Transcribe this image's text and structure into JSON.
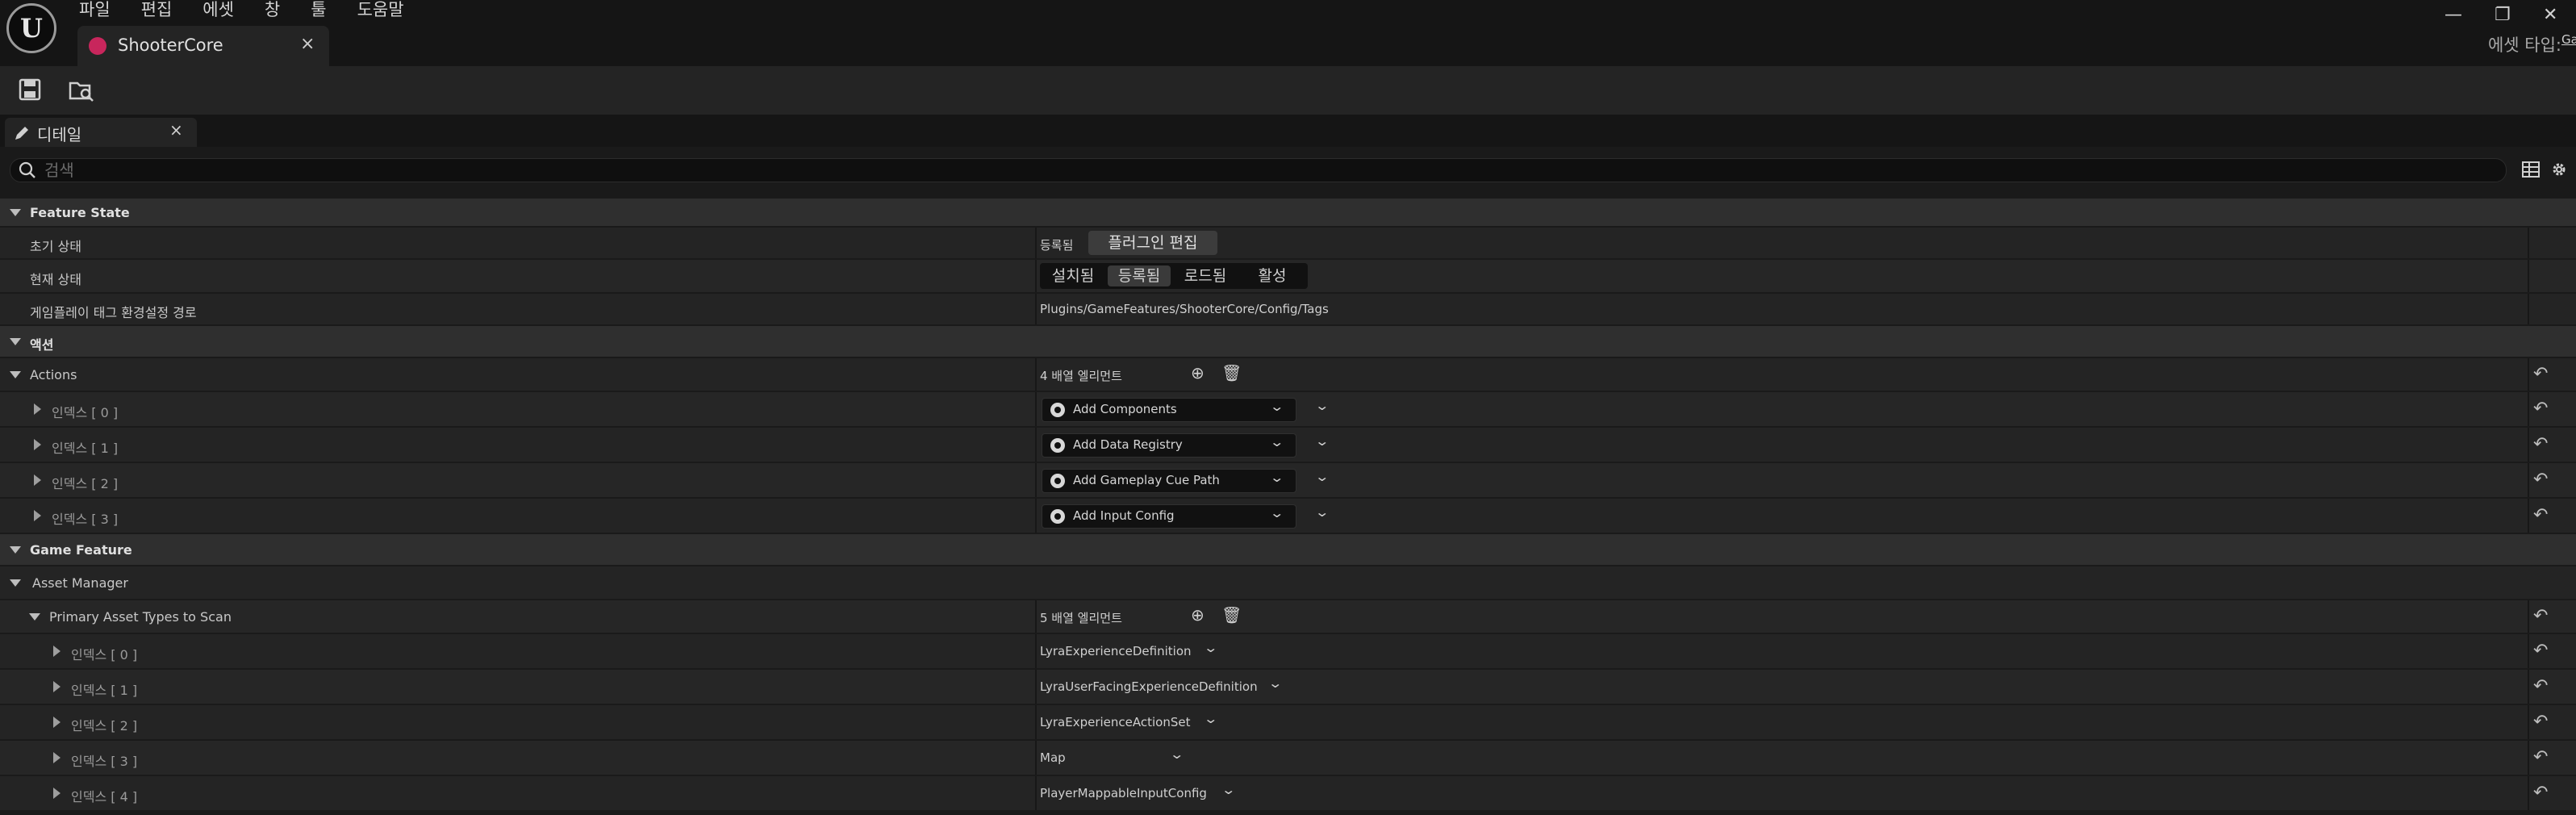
{
  "app": {
    "logo_glyph": "U",
    "menu": [
      "파일",
      "편집",
      "에셋",
      "창",
      "툴",
      "도움말"
    ],
    "tab_title": "ShooterCore",
    "asset_type_label": "에셋 타입:",
    "asset_type_value": "GameFeatureData",
    "window_controls": [
      "—",
      "❐",
      "✕"
    ],
    "accent_color": "#c8265c"
  },
  "details": {
    "tab_label": "디테일",
    "close_glyph": "×",
    "search_placeholder": "검색"
  },
  "feature_state": {
    "title": "Feature State",
    "initial_state_label": "초기 상태",
    "initial_state_value": "등록됨",
    "edit_plugin_button": "플러그인 편집",
    "current_state_label": "현재 상태",
    "states": [
      "설치됨",
      "등록됨",
      "로드됨",
      "활성"
    ],
    "selected_state": "등록됨",
    "tags_path_label": "게임플레이 태그 환경설정 경로",
    "tags_path_value": "Plugins/GameFeatures/ShooterCore/Config/Tags"
  },
  "actions_section": {
    "title": "액션",
    "actions_label": "Actions",
    "count_text": "4 배열 엘리먼트",
    "items": [
      {
        "index": "인덱스 [ 0 ]",
        "value": "Add Components"
      },
      {
        "index": "인덱스 [ 1 ]",
        "value": "Add Data Registry"
      },
      {
        "index": "인덱스 [ 2 ]",
        "value": "Add Gameplay Cue Path"
      },
      {
        "index": "인덱스 [ 3 ]",
        "value": "Add Input Config"
      }
    ]
  },
  "game_feature": {
    "title": "Game Feature",
    "asset_manager_label": "Asset Manager",
    "primary_types_label": "Primary Asset Types to Scan",
    "count_text": "5 배열 엘리먼트",
    "items": [
      {
        "index": "인덱스 [ 0 ]",
        "value": "LyraExperienceDefinition"
      },
      {
        "index": "인덱스 [ 1 ]",
        "value": "LyraUserFacingExperienceDefinition"
      },
      {
        "index": "인덱스 [ 2 ]",
        "value": "LyraExperienceActionSet"
      },
      {
        "index": "인덱스 [ 3 ]",
        "value": "Map"
      },
      {
        "index": "인덱스 [ 4 ]",
        "value": "PlayerMappableInputConfig"
      }
    ]
  },
  "glyphs": {
    "reset": "↶",
    "add": "⊕",
    "delete": "🗑",
    "chevron": "⌄"
  }
}
